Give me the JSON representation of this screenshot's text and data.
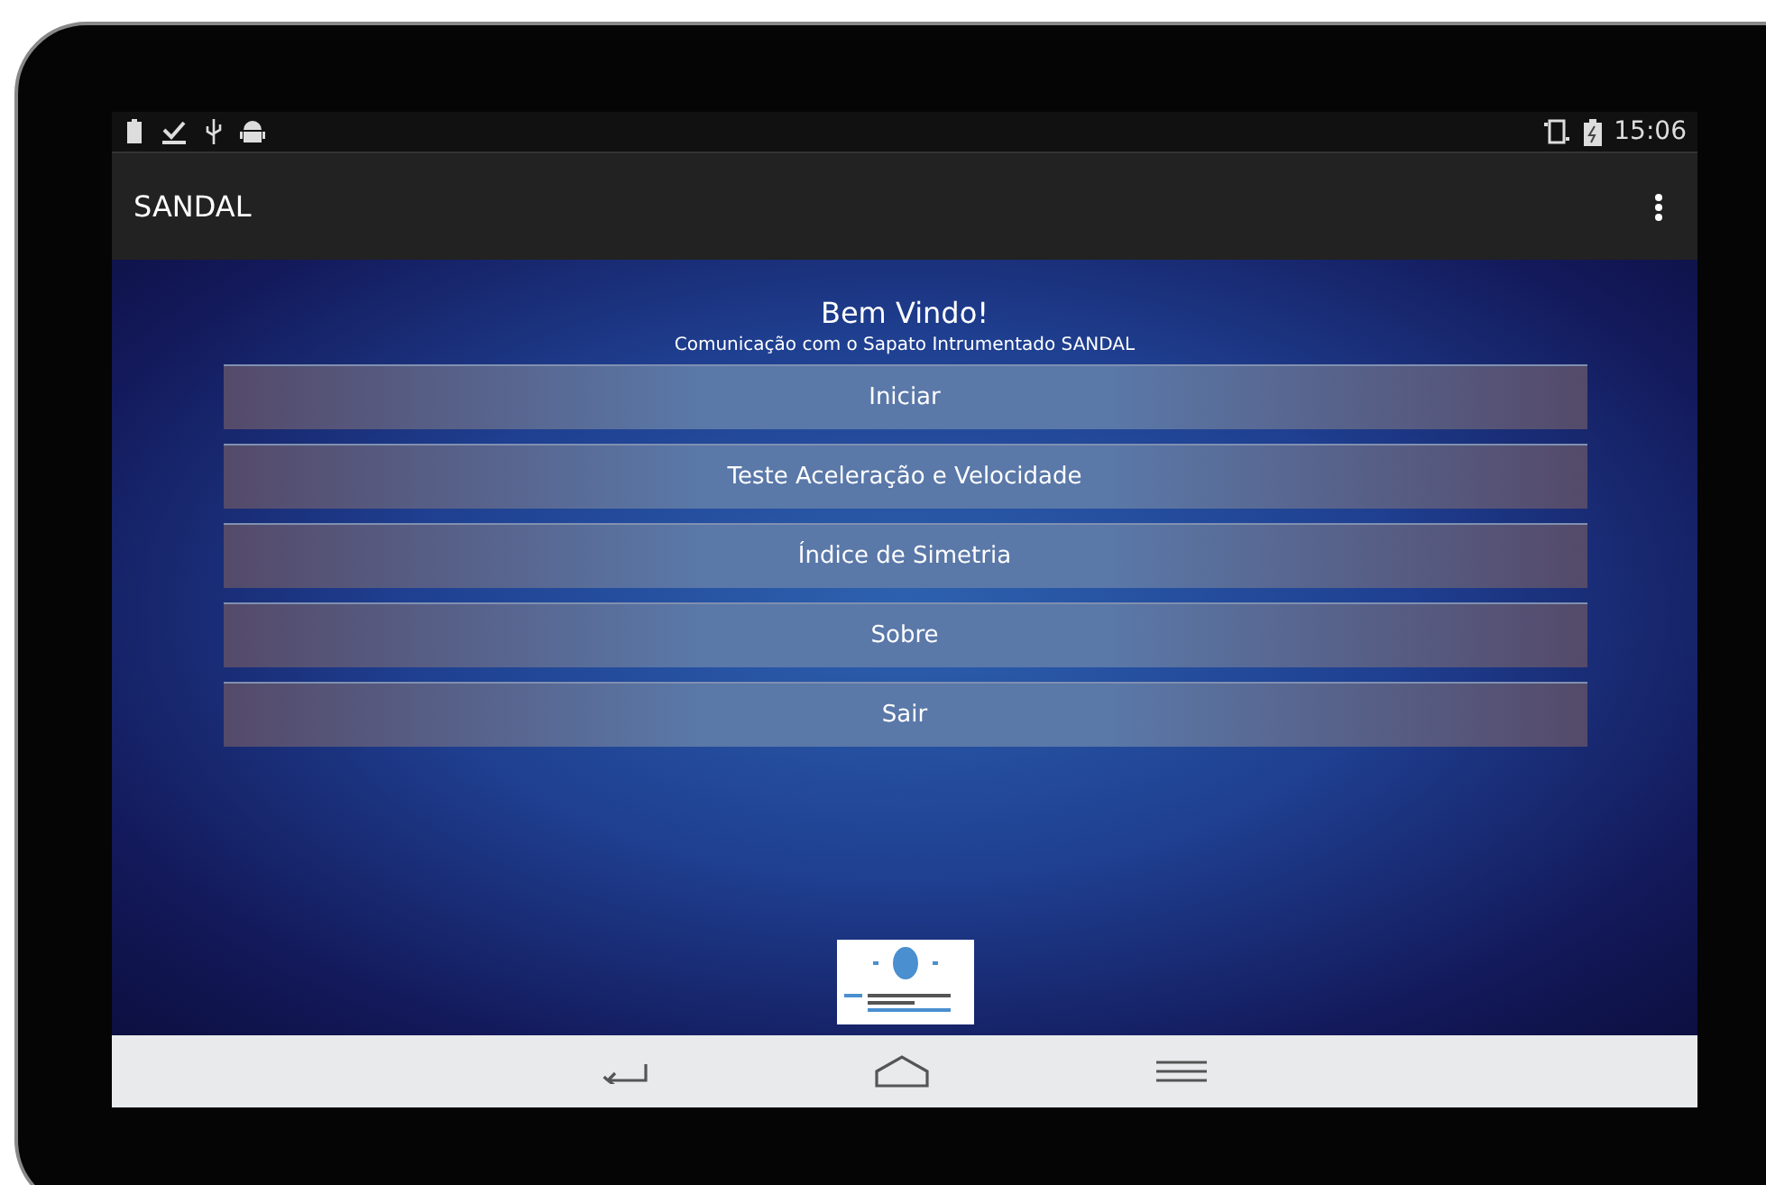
{
  "status_bar": {
    "time": "15:06"
  },
  "action_bar": {
    "title": "SANDAL"
  },
  "welcome": {
    "title": "Bem Vindo!",
    "subtitle": "Comunicação com o Sapato Intrumentado SANDAL"
  },
  "menu_buttons": [
    {
      "label": "Iniciar"
    },
    {
      "label": "Teste Aceleração e Velocidade"
    },
    {
      "label": "Índice de Simetria"
    },
    {
      "label": "Sobre"
    },
    {
      "label": "Sair"
    }
  ]
}
